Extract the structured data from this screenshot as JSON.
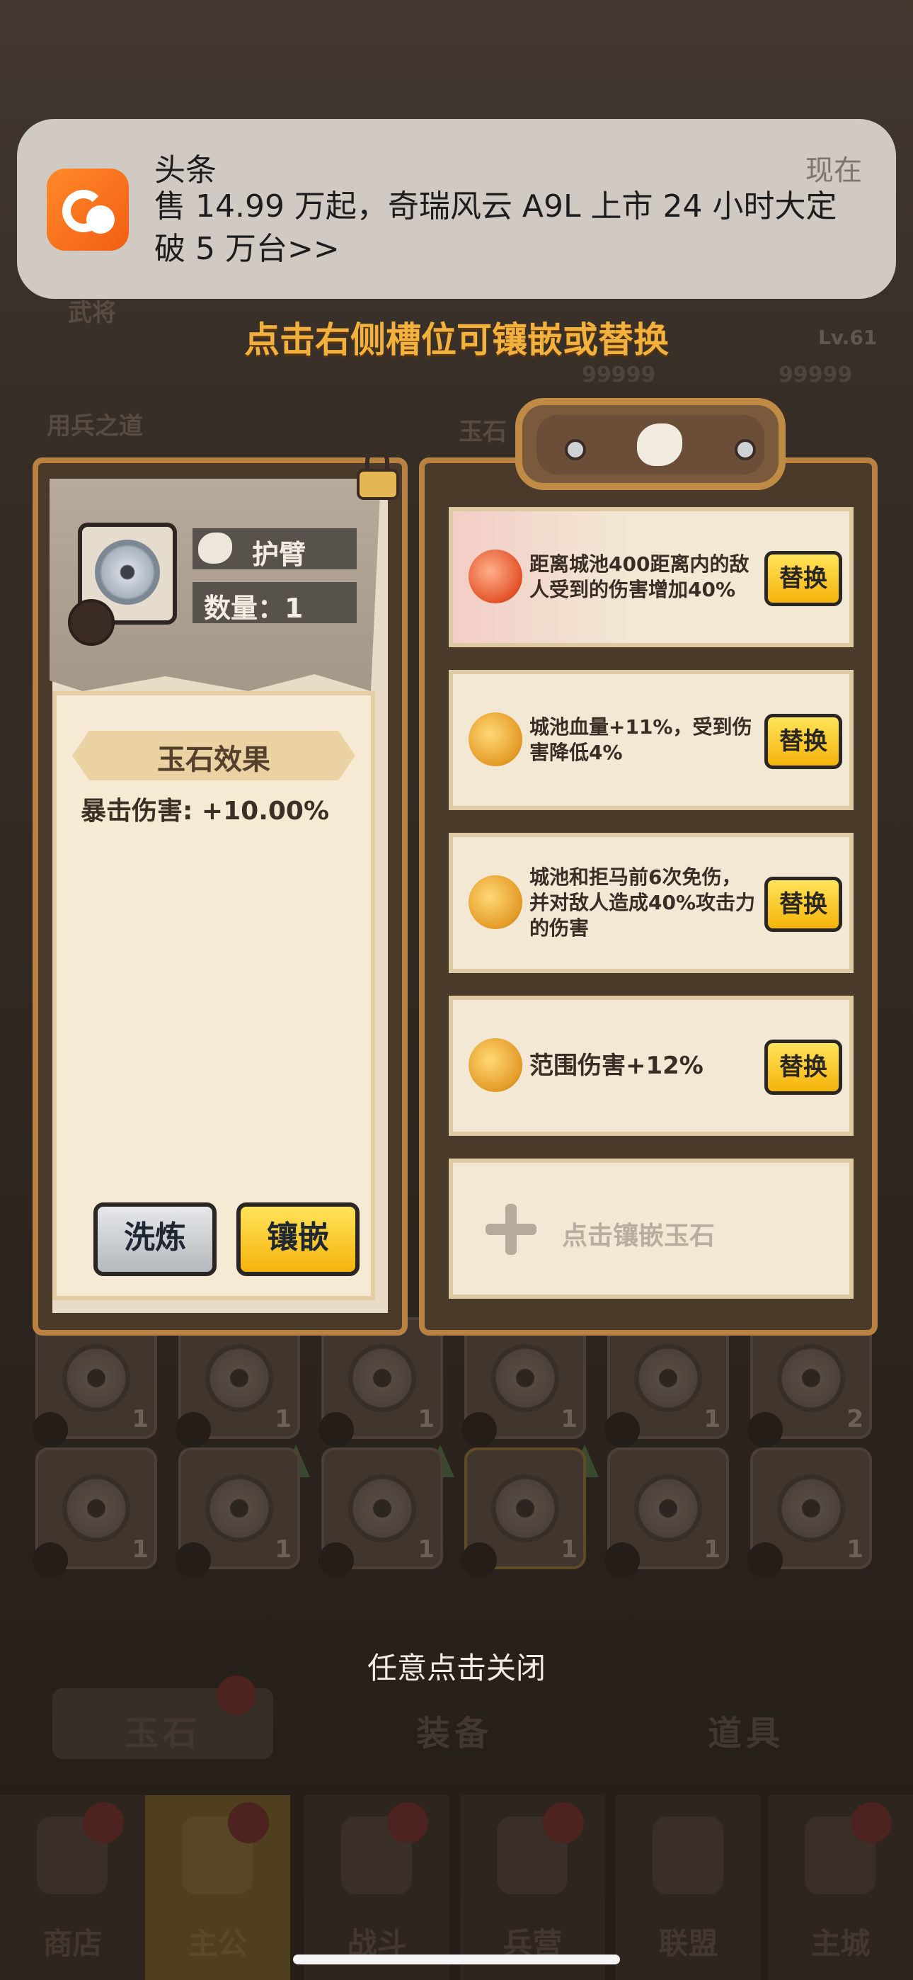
{
  "notification": {
    "app": "头条",
    "time": "现在",
    "body": "售 14.99 万起，奇瑞风云 A9L 上市 24 小时大定破 5 万台>>"
  },
  "hint": "点击右侧槽位可镶嵌或替换",
  "background_labels": {
    "general": "武将",
    "strategy": "用兵之道",
    "jade": "玉石",
    "level": "Lv.61",
    "score_a": "99999",
    "score_b": "99999"
  },
  "item": {
    "name": "护臂",
    "quantity": "数量：1"
  },
  "effect": {
    "title": "玉石效果",
    "stat": "暴击伤害: +10.00%"
  },
  "buttons": {
    "wash": "洗炼",
    "inlay": "镶嵌"
  },
  "slots": [
    {
      "text": "距离城池400距离内的敌人受到的伤害增加40%",
      "action": "替换",
      "orb": "red"
    },
    {
      "text": "城池血量+11%，受到伤害降低4%",
      "action": "替换",
      "orb": "gold"
    },
    {
      "text": "城池和拒马前6次免伤，并对敌人造成40%攻击力的伤害",
      "action": "替换",
      "orb": "gold"
    },
    {
      "text": "范围伤害+12%",
      "action": "替换",
      "orb": "gold"
    }
  ],
  "empty_slot": "点击镶嵌玉石",
  "inventory_counts_row1": [
    "1",
    "1",
    "1",
    "1",
    "1",
    "2"
  ],
  "inventory_counts_row2": [
    "1",
    "1",
    "1",
    "1",
    "1",
    "1"
  ],
  "close_hint": "任意点击关闭",
  "tabs": [
    "玉石",
    "装备",
    "道具"
  ],
  "nav": [
    "商店",
    "主公",
    "战斗",
    "兵营",
    "联盟",
    "主城"
  ],
  "colors": {
    "hint": "#f2b13c",
    "button_yellow": "#f5b30b",
    "panel_border": "#b98243"
  }
}
